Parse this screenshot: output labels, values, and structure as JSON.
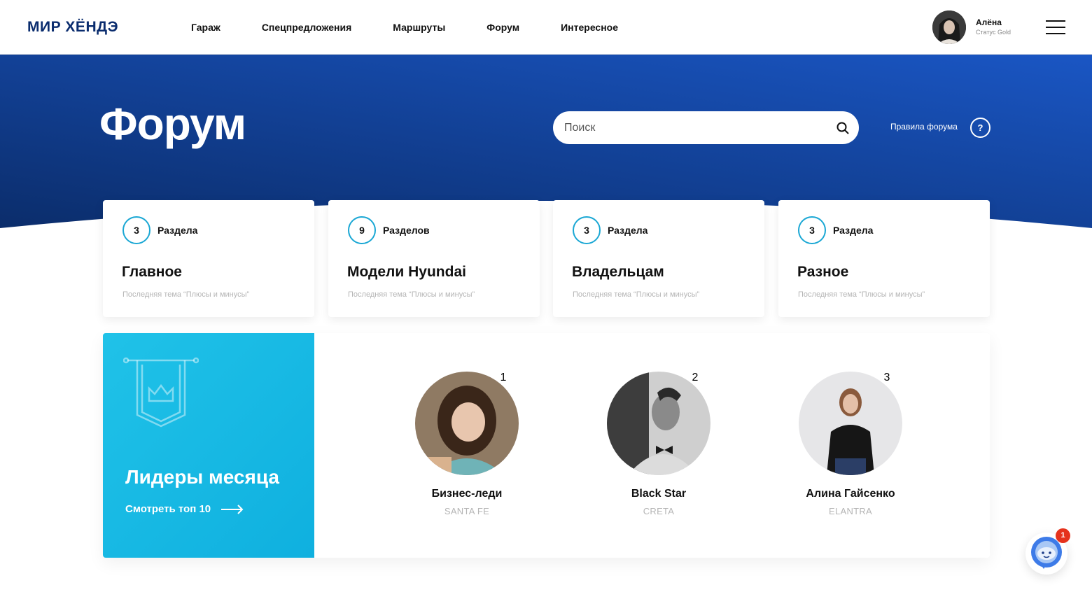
{
  "header": {
    "logo": "МИР ХЁНДЭ",
    "nav": [
      "Гараж",
      "Спецпредложения",
      "Маршруты",
      "Форум",
      "Интересное"
    ],
    "user": {
      "name": "Алёна",
      "status": "Статус Gold",
      "avatar_icon": "user-avatar"
    }
  },
  "hero": {
    "title": "Форум",
    "search_placeholder": "Поиск",
    "rules_label": "Правила форума",
    "help_label": "?"
  },
  "sections": [
    {
      "count": "3",
      "count_label": "Раздела",
      "title": "Главное",
      "last_topic": "Последняя тема “Плюсы и минусы”"
    },
    {
      "count": "9",
      "count_label": "Разделов",
      "title": "Модели Hyundai",
      "last_topic": "Последняя тема “Плюсы и минусы”"
    },
    {
      "count": "3",
      "count_label": "Раздела",
      "title": "Владельцам",
      "last_topic": "Последняя тема “Плюсы и минусы”"
    },
    {
      "count": "3",
      "count_label": "Раздела",
      "title": "Разное",
      "last_topic": "Последняя тема “Плюсы и минусы”"
    }
  ],
  "leaders": {
    "title": "Лидеры месяца",
    "link_label": "Смотреть топ 10",
    "items": [
      {
        "rank": "1",
        "name": "Бизнес-леди",
        "model": "SANTA FE"
      },
      {
        "rank": "2",
        "name": "Black Star",
        "model": "CRETA"
      },
      {
        "rank": "3",
        "name": "Алина Гайсенко",
        "model": "ELANTRA"
      }
    ]
  },
  "chat": {
    "badge": "1",
    "icon": "chatbot-icon"
  },
  "colors": {
    "brand": "#0a2c6e",
    "hero_dark": "#0b2d6b",
    "hero_light": "#1a56c4",
    "accent": "#1aa7d4",
    "badge": "#e5321c"
  }
}
